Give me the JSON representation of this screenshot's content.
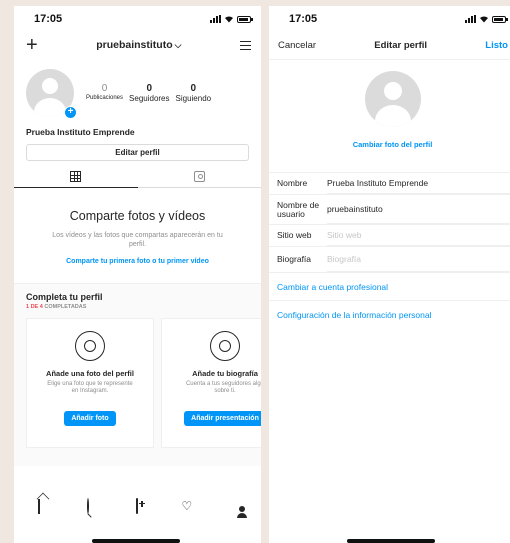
{
  "left": {
    "status_time": "17:05",
    "header": {
      "username": "pruebainstituto",
      "chevron": "⌵"
    },
    "stats": [
      {
        "num": "0",
        "label": "Publicaciones"
      },
      {
        "num": "0",
        "label": "Seguidores"
      },
      {
        "num": "0",
        "label": "Siguiendo"
      }
    ],
    "display_name": "Prueba Instituto Emprende",
    "edit_profile_label": "Editar perfil",
    "empty": {
      "title": "Comparte fotos y vídeos",
      "description": "Los vídeos y las fotos que compartas aparecerán en tu perfil.",
      "link": "Comparte tu primera foto o tu primer vídeo"
    },
    "complete": {
      "title": "Completa tu perfil",
      "progress_count": "1 DE 4",
      "progress_text": " COMPLETADAS",
      "cards": [
        {
          "title": "Añade una foto del perfil",
          "desc": "Elige una foto que te represente en Instagram.",
          "button": "Añadir foto",
          "icon": "user-circle-icon"
        },
        {
          "title": "Añade tu biografía",
          "desc": "Cuenta a tus seguidores algo sobre ti.",
          "button": "Añadir presentación",
          "icon": "speech-bubble-icon"
        }
      ]
    },
    "accent": "#0095f6"
  },
  "right": {
    "status_time": "17:05",
    "nav": {
      "cancel": "Cancelar",
      "title": "Editar perfil",
      "done": "Listo"
    },
    "change_photo": "Cambiar foto del perfil",
    "fields": [
      {
        "label": "Nombre",
        "value": "Prueba Instituto Emprende",
        "placeholder": false
      },
      {
        "label": "Nombre de usuario",
        "value": "pruebainstituto",
        "placeholder": false
      },
      {
        "label": "Sitio web",
        "value": "Sitio web",
        "placeholder": true
      },
      {
        "label": "Biografía",
        "value": "Biografía",
        "placeholder": true
      }
    ],
    "links": [
      "Cambiar a cuenta profesional",
      "Configuración de la información personal"
    ]
  }
}
